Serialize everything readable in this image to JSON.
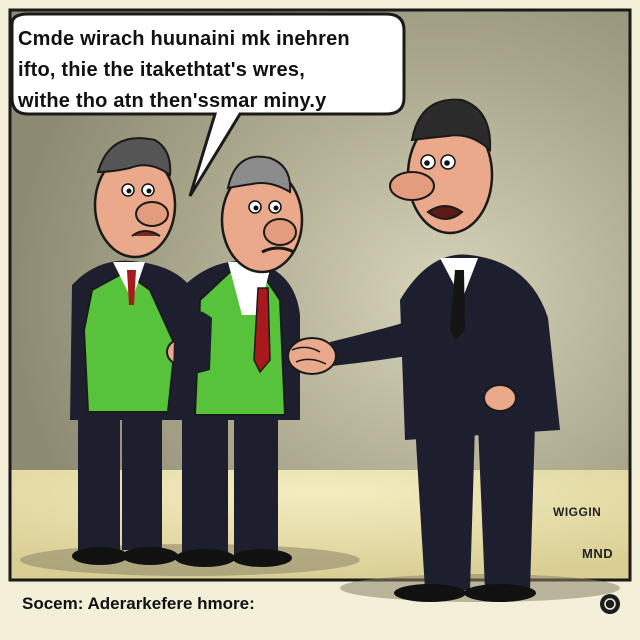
{
  "speech_bubble": {
    "lines": [
      "Cmde wirach huunaini mk inehren",
      "ifto, thie the itakethtat's wres,",
      "withe tho atn then'ssmar miny.y"
    ]
  },
  "signature": "WIGGIN",
  "artist_mark": "MND",
  "caption": "Socem: Aderarkefere hmore:",
  "colors": {
    "background": "#c9c6aa",
    "green_vest": "#57c33a",
    "dark_suit": "#1d1f2e",
    "tie_red": "#a8191b",
    "skin": "#e9a98a"
  },
  "icons": [
    "speech-bubble-icon",
    "copyright-badge-icon"
  ]
}
